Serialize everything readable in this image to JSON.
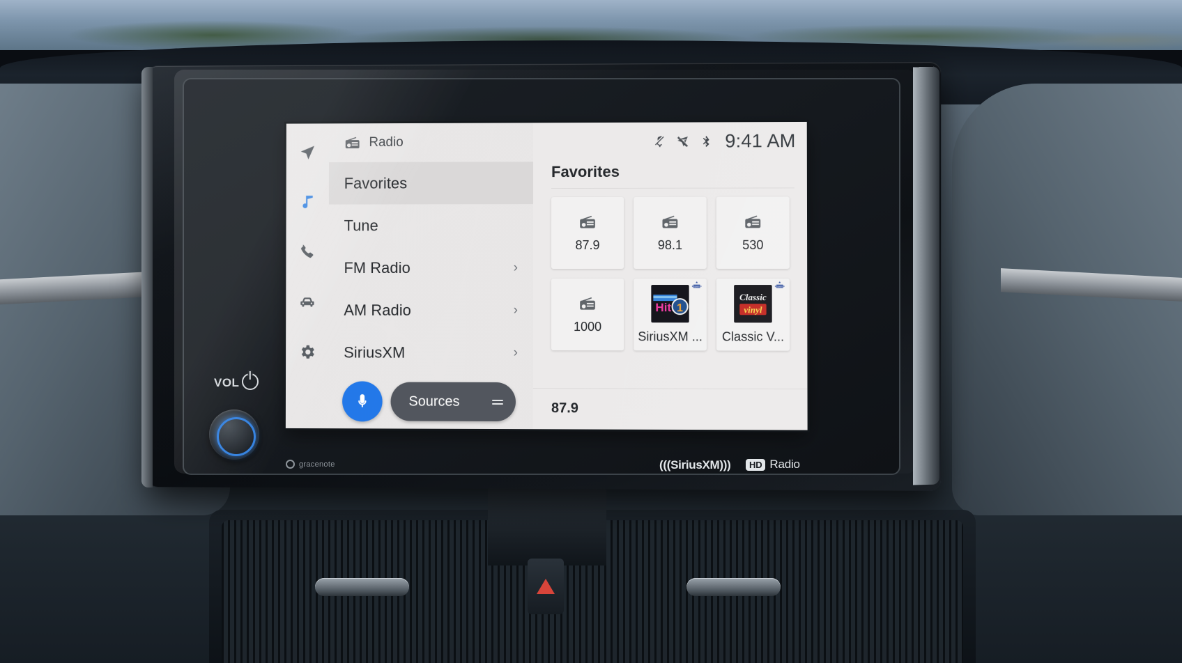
{
  "exterior": {
    "vol_label": "VOL",
    "power_icon": "power-icon"
  },
  "headunit_brands": {
    "gracenote": "gracenote",
    "siriusxm": "(((SiriusXM)))",
    "hd_badge": "HD",
    "hd_text": "Radio"
  },
  "screen": {
    "rail": [
      {
        "name": "navigation-icon",
        "label": "Navigation",
        "active": false
      },
      {
        "name": "music-note-icon",
        "label": "Audio",
        "active": true
      },
      {
        "name": "phone-icon",
        "label": "Phone",
        "active": false
      },
      {
        "name": "car-icon",
        "label": "Vehicle",
        "active": false
      },
      {
        "name": "gear-icon",
        "label": "Settings",
        "active": false
      }
    ],
    "pane": {
      "icon": "radio-icon",
      "title": "Radio",
      "items": [
        {
          "label": "Favorites",
          "selected": true,
          "chevron": ""
        },
        {
          "label": "Tune",
          "selected": false,
          "chevron": ""
        },
        {
          "label": "FM Radio",
          "selected": false,
          "chevron": "›"
        },
        {
          "label": "AM Radio",
          "selected": false,
          "chevron": "›"
        },
        {
          "label": "SiriusXM",
          "selected": false,
          "chevron": "›"
        }
      ]
    },
    "bottom_bar": {
      "mic_icon": "microphone-icon",
      "sources_label": "Sources",
      "sources_menu_icon": "hamburger-icon"
    },
    "statusbar": {
      "icons": [
        {
          "name": "phone-mute-icon"
        },
        {
          "name": "nav-muted-icon"
        },
        {
          "name": "bluetooth-icon"
        }
      ],
      "time": "9:41 AM"
    },
    "content": {
      "heading": "Favorites",
      "favorites": [
        {
          "label": "87.9",
          "kind": "radio",
          "satellite": false
        },
        {
          "label": "98.1",
          "kind": "radio",
          "satellite": false
        },
        {
          "label": "530",
          "kind": "radio",
          "satellite": false
        },
        {
          "label": "1000",
          "kind": "radio",
          "satellite": false
        },
        {
          "label": "SiriusXM ...",
          "kind": "art-hits1",
          "satellite": true
        },
        {
          "label": "Classic V...",
          "kind": "art-vinyl",
          "satellite": true
        }
      ],
      "now_playing": "87.9"
    },
    "colors": {
      "accent_blue": "#1a73e8",
      "screen_bg": "#eceaea",
      "pane_bg": "#e8e6e6",
      "selected_row": "#d9d7d7",
      "sources_btn": "#4b4f57"
    }
  }
}
